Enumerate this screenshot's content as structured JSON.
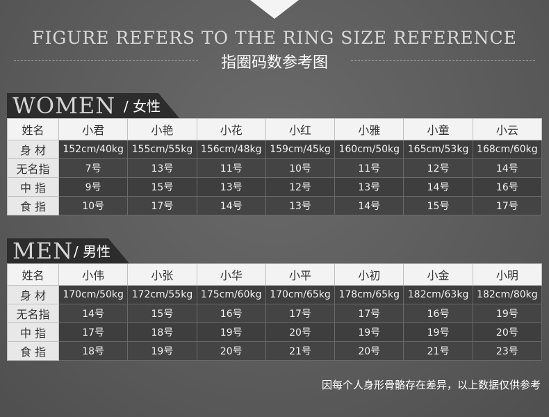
{
  "header": {
    "en_title": "FIGURE REFERS TO THE RING SIZE REFERENCE",
    "cn_title": "指圈码数参考图"
  },
  "women": {
    "section_en": "WOMEN",
    "section_cn": "/ 女性",
    "header_label": "姓名",
    "names": [
      "小君",
      "小艳",
      "小花",
      "小红",
      "小雅",
      "小童",
      "小云"
    ],
    "rows": [
      {
        "label": "身  材",
        "values": [
          "152cm/40kg",
          "155cm/55kg",
          "156cm/48kg",
          "159cm/45kg",
          "160cm/50kg",
          "165cm/53kg",
          "168cm/60kg"
        ]
      },
      {
        "label": "无名指",
        "values": [
          "7号",
          "13号",
          "11号",
          "10号",
          "11号",
          "12号",
          "14号"
        ]
      },
      {
        "label": "中  指",
        "values": [
          "9号",
          "15号",
          "13号",
          "12号",
          "13号",
          "14号",
          "16号"
        ]
      },
      {
        "label": "食  指",
        "values": [
          "10号",
          "17号",
          "14号",
          "13号",
          "14号",
          "15号",
          "17号"
        ]
      }
    ]
  },
  "men": {
    "section_en": "MEN",
    "section_cn": "/ 男性",
    "header_label": "姓名",
    "names": [
      "小伟",
      "小张",
      "小华",
      "小平",
      "小初",
      "小金",
      "小明"
    ],
    "rows": [
      {
        "label": "身  材",
        "values": [
          "170cm/50kg",
          "172cm/55kg",
          "175cm/60kg",
          "170cm/65kg",
          "178cm/65kg",
          "182cm/63kg",
          "182cm/80kg"
        ]
      },
      {
        "label": "无名指",
        "values": [
          "14号",
          "15号",
          "16号",
          "17号",
          "17号",
          "16号",
          "19号"
        ]
      },
      {
        "label": "中  指",
        "values": [
          "17号",
          "18号",
          "19号",
          "20号",
          "19号",
          "19号",
          "20号"
        ]
      },
      {
        "label": "食  指",
        "values": [
          "18号",
          "19号",
          "20号",
          "21号",
          "20号",
          "21号",
          "23号"
        ]
      }
    ]
  },
  "footer": {
    "note": "因每个人身形骨骼存在差异，以上数据仅供参考"
  }
}
